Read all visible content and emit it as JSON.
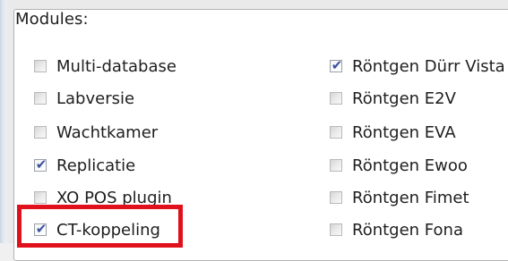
{
  "group": {
    "title": "Modules:"
  },
  "modules_left": [
    {
      "label": "Multi-database",
      "checked": false
    },
    {
      "label": "Labversie",
      "checked": false
    },
    {
      "label": "Wachtkamer",
      "checked": false
    },
    {
      "label": "Replicatie",
      "checked": true
    },
    {
      "label": "XO POS plugin",
      "checked": false
    },
    {
      "label": "CT-koppeling",
      "checked": true
    }
  ],
  "modules_right": [
    {
      "label": "Röntgen Dürr Vista",
      "checked": true
    },
    {
      "label": "Röntgen E2V",
      "checked": false
    },
    {
      "label": "Röntgen EVA",
      "checked": false
    },
    {
      "label": "Röntgen Ewoo",
      "checked": false
    },
    {
      "label": "Röntgen Fimet",
      "checked": false
    },
    {
      "label": "Röntgen Fona",
      "checked": false
    }
  ],
  "check_glyph": "✔",
  "colors": {
    "highlight": "#e0101c",
    "checkmark": "#3a4f9f"
  }
}
